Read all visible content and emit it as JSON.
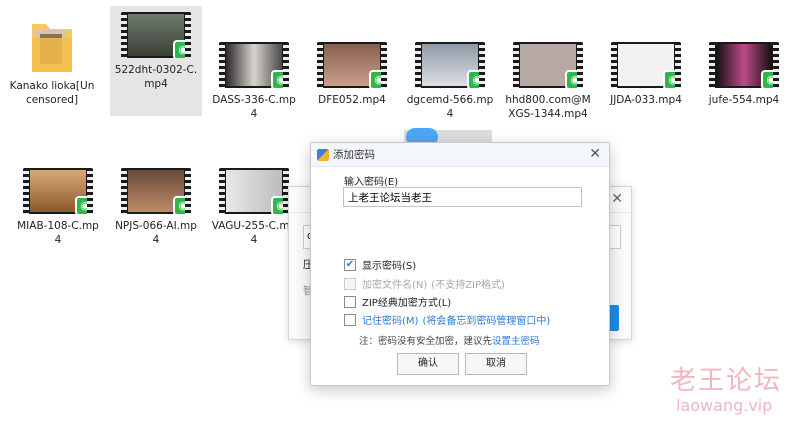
{
  "files_row1": [
    {
      "name": "Kanako lioka[Uncensored]",
      "kind": "folder"
    },
    {
      "name": "522dht-0302-C.mp4",
      "kind": "video",
      "selected": true
    },
    {
      "name": "DASS-336-C.mp4",
      "kind": "video"
    },
    {
      "name": "DFE052.mp4",
      "kind": "video"
    },
    {
      "name": "dgcemd-566.mp4",
      "kind": "video"
    },
    {
      "name": "hhd800.com@MXGS-1344.mp4",
      "kind": "video"
    },
    {
      "name": "JJDA-033.mp4",
      "kind": "video"
    },
    {
      "name": "jufe-554.mp4",
      "kind": "video"
    }
  ],
  "files_row2": [
    {
      "name": "MIAB-108-C.mp4",
      "kind": "video"
    },
    {
      "name": "NPJS-066-AI.mp4",
      "kind": "video"
    },
    {
      "name": "VAGU-255-C.mp4",
      "kind": "video"
    }
  ],
  "bg_dialog": {
    "edit_prefix": "d",
    "label_a": "压",
    "label_b": "智"
  },
  "dialog": {
    "title": "添加密码",
    "close_glyph": "✕",
    "input_label": "输入密码(E)",
    "password_value": "上老王论坛当老王",
    "show_password": "显示密码(S)",
    "encrypt_names": "加密文件名(N)",
    "encrypt_names_note": "(不支持ZIP格式)",
    "zip_classic": "ZIP经典加密方式(L)",
    "remember": "记住密码(M)",
    "remember_note": "(将会备忘到密码管理窗口中)",
    "note_prefix": "注：密码没有安全加密，建议先",
    "note_link": "设置主密码",
    "ok": "确认",
    "cancel": "取消"
  },
  "watermark": {
    "cn": "老王论坛",
    "en": "laowang.vip"
  },
  "colors": {
    "accent": "#2a7ad6",
    "badge": "#2db84b",
    "watermark": "#f3b6bd"
  }
}
